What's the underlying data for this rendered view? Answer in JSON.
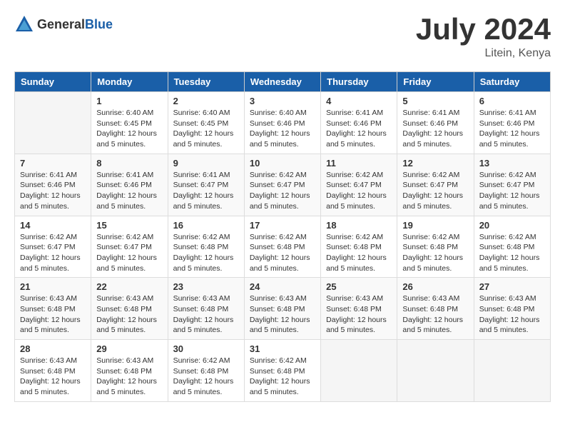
{
  "logo": {
    "general": "General",
    "blue": "Blue"
  },
  "title": {
    "month_year": "July 2024",
    "location": "Litein, Kenya"
  },
  "days_of_week": [
    "Sunday",
    "Monday",
    "Tuesday",
    "Wednesday",
    "Thursday",
    "Friday",
    "Saturday"
  ],
  "weeks": [
    [
      {
        "day": "",
        "text": ""
      },
      {
        "day": "1",
        "text": "Sunrise: 6:40 AM\nSunset: 6:45 PM\nDaylight: 12 hours\nand 5 minutes."
      },
      {
        "day": "2",
        "text": "Sunrise: 6:40 AM\nSunset: 6:45 PM\nDaylight: 12 hours\nand 5 minutes."
      },
      {
        "day": "3",
        "text": "Sunrise: 6:40 AM\nSunset: 6:46 PM\nDaylight: 12 hours\nand 5 minutes."
      },
      {
        "day": "4",
        "text": "Sunrise: 6:41 AM\nSunset: 6:46 PM\nDaylight: 12 hours\nand 5 minutes."
      },
      {
        "day": "5",
        "text": "Sunrise: 6:41 AM\nSunset: 6:46 PM\nDaylight: 12 hours\nand 5 minutes."
      },
      {
        "day": "6",
        "text": "Sunrise: 6:41 AM\nSunset: 6:46 PM\nDaylight: 12 hours\nand 5 minutes."
      }
    ],
    [
      {
        "day": "7",
        "text": "Sunrise: 6:41 AM\nSunset: 6:46 PM\nDaylight: 12 hours\nand 5 minutes."
      },
      {
        "day": "8",
        "text": "Sunrise: 6:41 AM\nSunset: 6:46 PM\nDaylight: 12 hours\nand 5 minutes."
      },
      {
        "day": "9",
        "text": "Sunrise: 6:41 AM\nSunset: 6:47 PM\nDaylight: 12 hours\nand 5 minutes."
      },
      {
        "day": "10",
        "text": "Sunrise: 6:42 AM\nSunset: 6:47 PM\nDaylight: 12 hours\nand 5 minutes."
      },
      {
        "day": "11",
        "text": "Sunrise: 6:42 AM\nSunset: 6:47 PM\nDaylight: 12 hours\nand 5 minutes."
      },
      {
        "day": "12",
        "text": "Sunrise: 6:42 AM\nSunset: 6:47 PM\nDaylight: 12 hours\nand 5 minutes."
      },
      {
        "day": "13",
        "text": "Sunrise: 6:42 AM\nSunset: 6:47 PM\nDaylight: 12 hours\nand 5 minutes."
      }
    ],
    [
      {
        "day": "14",
        "text": "Sunrise: 6:42 AM\nSunset: 6:47 PM\nDaylight: 12 hours\nand 5 minutes."
      },
      {
        "day": "15",
        "text": "Sunrise: 6:42 AM\nSunset: 6:47 PM\nDaylight: 12 hours\nand 5 minutes."
      },
      {
        "day": "16",
        "text": "Sunrise: 6:42 AM\nSunset: 6:48 PM\nDaylight: 12 hours\nand 5 minutes."
      },
      {
        "day": "17",
        "text": "Sunrise: 6:42 AM\nSunset: 6:48 PM\nDaylight: 12 hours\nand 5 minutes."
      },
      {
        "day": "18",
        "text": "Sunrise: 6:42 AM\nSunset: 6:48 PM\nDaylight: 12 hours\nand 5 minutes."
      },
      {
        "day": "19",
        "text": "Sunrise: 6:42 AM\nSunset: 6:48 PM\nDaylight: 12 hours\nand 5 minutes."
      },
      {
        "day": "20",
        "text": "Sunrise: 6:42 AM\nSunset: 6:48 PM\nDaylight: 12 hours\nand 5 minutes."
      }
    ],
    [
      {
        "day": "21",
        "text": "Sunrise: 6:43 AM\nSunset: 6:48 PM\nDaylight: 12 hours\nand 5 minutes."
      },
      {
        "day": "22",
        "text": "Sunrise: 6:43 AM\nSunset: 6:48 PM\nDaylight: 12 hours\nand 5 minutes."
      },
      {
        "day": "23",
        "text": "Sunrise: 6:43 AM\nSunset: 6:48 PM\nDaylight: 12 hours\nand 5 minutes."
      },
      {
        "day": "24",
        "text": "Sunrise: 6:43 AM\nSunset: 6:48 PM\nDaylight: 12 hours\nand 5 minutes."
      },
      {
        "day": "25",
        "text": "Sunrise: 6:43 AM\nSunset: 6:48 PM\nDaylight: 12 hours\nand 5 minutes."
      },
      {
        "day": "26",
        "text": "Sunrise: 6:43 AM\nSunset: 6:48 PM\nDaylight: 12 hours\nand 5 minutes."
      },
      {
        "day": "27",
        "text": "Sunrise: 6:43 AM\nSunset: 6:48 PM\nDaylight: 12 hours\nand 5 minutes."
      }
    ],
    [
      {
        "day": "28",
        "text": "Sunrise: 6:43 AM\nSunset: 6:48 PM\nDaylight: 12 hours\nand 5 minutes."
      },
      {
        "day": "29",
        "text": "Sunrise: 6:43 AM\nSunset: 6:48 PM\nDaylight: 12 hours\nand 5 minutes."
      },
      {
        "day": "30",
        "text": "Sunrise: 6:42 AM\nSunset: 6:48 PM\nDaylight: 12 hours\nand 5 minutes."
      },
      {
        "day": "31",
        "text": "Sunrise: 6:42 AM\nSunset: 6:48 PM\nDaylight: 12 hours\nand 5 minutes."
      },
      {
        "day": "",
        "text": ""
      },
      {
        "day": "",
        "text": ""
      },
      {
        "day": "",
        "text": ""
      }
    ]
  ]
}
